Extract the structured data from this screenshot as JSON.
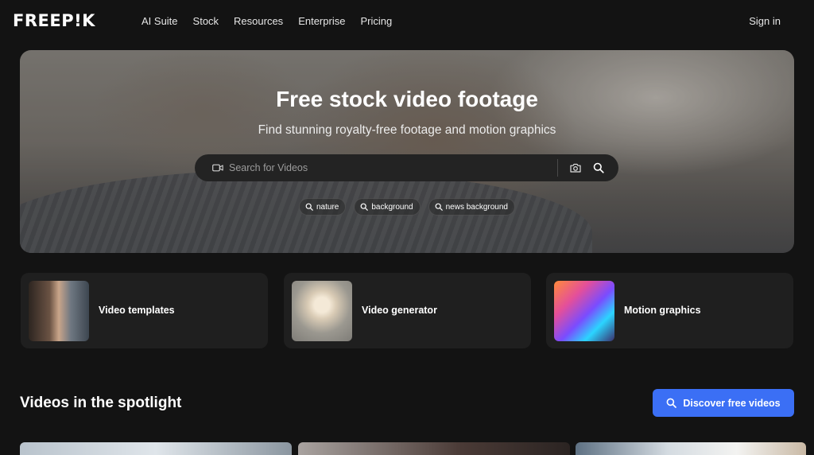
{
  "header": {
    "logo": "FREEP!K",
    "nav": [
      "AI Suite",
      "Stock",
      "Resources",
      "Enterprise",
      "Pricing"
    ],
    "sign_in": "Sign in"
  },
  "hero": {
    "title": "Free stock video footage",
    "subtitle": "Find stunning royalty-free footage and motion graphics",
    "search": {
      "placeholder": "Search for Videos",
      "value": "",
      "left_icon": "video-camera-icon",
      "right_icons": [
        "camera-icon",
        "search-icon"
      ]
    },
    "chips": [
      "nature",
      "background",
      "news background"
    ]
  },
  "cards": [
    {
      "label": "Video templates",
      "thumb": "woman-glitch-thumbnail"
    },
    {
      "label": "Video generator",
      "thumb": "white-flower-thumbnail"
    },
    {
      "label": "Motion graphics",
      "thumb": "colorful-profile-thumbnail"
    }
  ],
  "spotlight": {
    "title": "Videos in the spotlight",
    "button": "Discover free videos"
  },
  "colors": {
    "background": "#131313",
    "card": "#1f1f1f",
    "accent": "#3b6ff5"
  }
}
